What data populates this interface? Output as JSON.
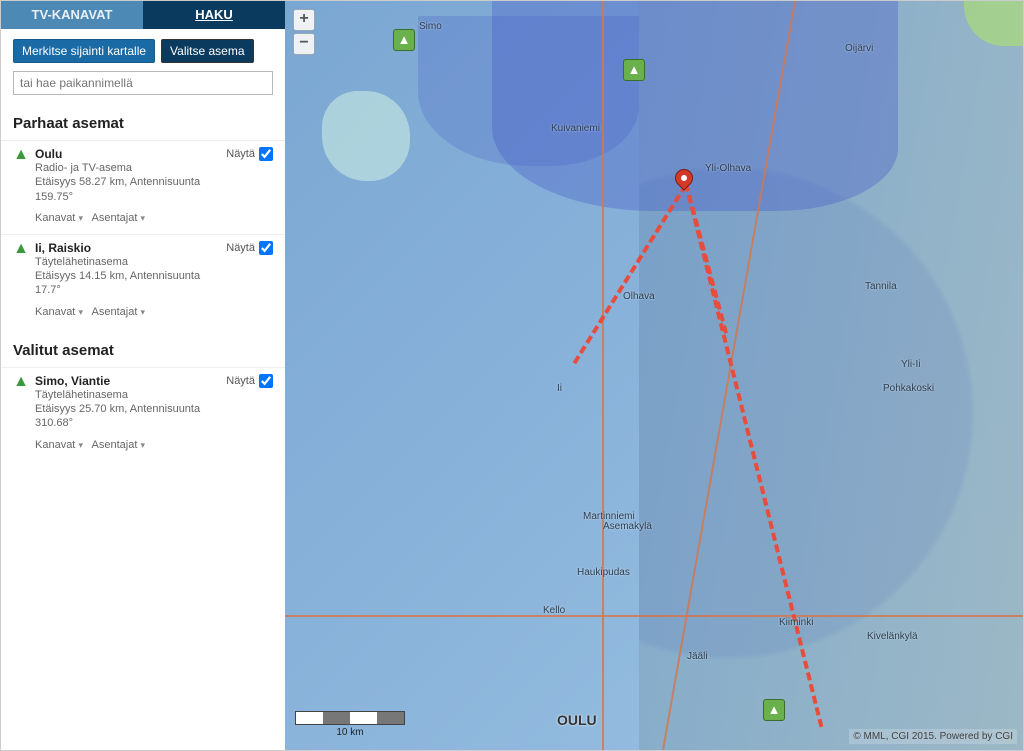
{
  "tabs": {
    "inactive": "TV-KANAVAT",
    "active": "HAKU"
  },
  "controls": {
    "mark_location": "Merkitse sijainti kartalle",
    "choose_station": "Valitse asema",
    "search_placeholder": "tai hae paikannimellä"
  },
  "sections": {
    "best_title": "Parhaat asemat",
    "selected_title": "Valitut asemat",
    "show_label": "Näytä",
    "channels_label": "Kanavat",
    "installers_label": "Asentajat"
  },
  "best_stations": [
    {
      "name": "Oulu",
      "type": "Radio- ja TV-asema",
      "dist_line": "Etäisyys 58.27 km, Antennisuunta 159.75°",
      "checked": true
    },
    {
      "name": "Ii, Raiskio",
      "type": "Täytelähetinasema",
      "dist_line": "Etäisyys 14.15 km, Antennisuunta 17.7°",
      "checked": true
    }
  ],
  "selected_stations": [
    {
      "name": "Simo, Viantie",
      "type": "Täytelähetinasema",
      "dist_line": "Etäisyys 25.70 km, Antennisuunta 310.68°",
      "checked": true
    }
  ],
  "map": {
    "scale_label": "10 km",
    "attribution": "© MML, CGI 2015. Powered by CGI",
    "city_label": "OULU",
    "places": {
      "simo": "Simo",
      "kuivaniem": "Kuivaniemi",
      "yliolhava": "Yli-Olhava",
      "oijarvi": "Oijärvi",
      "tannila": "Tannila",
      "yli_ii": "Yli-Ii",
      "pohkakoski": "Pohkakoski",
      "haukipudas": "Haukipudas",
      "kello": "Kello",
      "kiminki": "Kiiminki",
      "martinniemi": "Martinniemi",
      "olhava": "Olhava",
      "ii_label": "Ii",
      "asemakyla": "Asemakylä",
      "kivelankyla": "Kivelänkylä",
      "jaali": "Jääli"
    }
  }
}
